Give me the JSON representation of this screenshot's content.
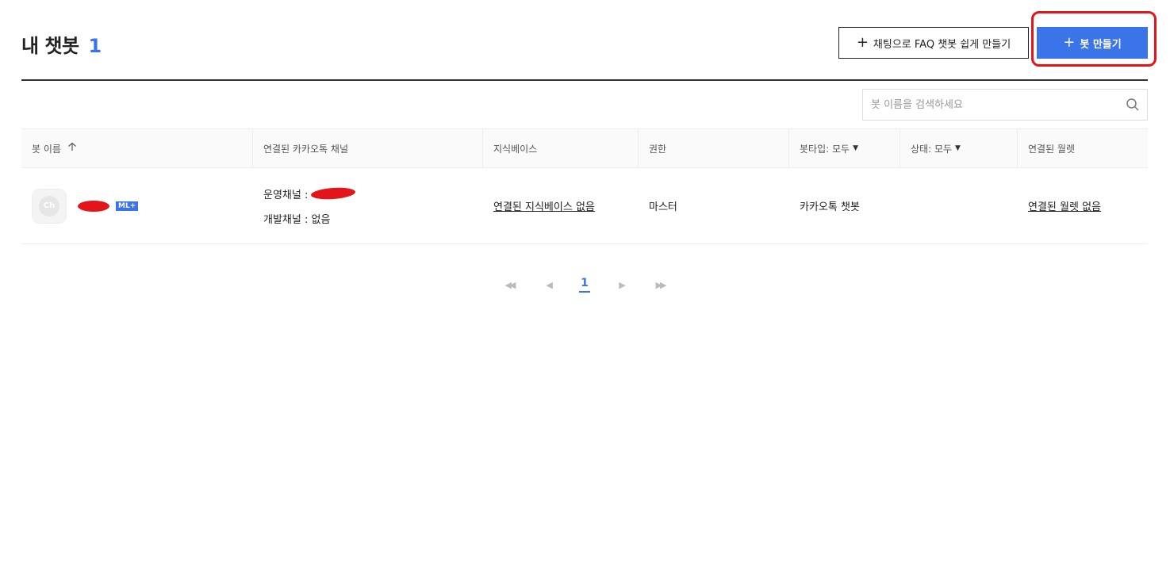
{
  "header": {
    "title": "내 챗봇",
    "count": "1",
    "faq_button_label": "채팅으로 FAQ 챗봇 쉽게 만들기",
    "create_button_label": "봇 만들기",
    "plus_symbol": "+"
  },
  "search": {
    "placeholder": "봇 이름을 검색하세요"
  },
  "table": {
    "headers": {
      "bot_name": "봇 이름",
      "channel": "연결된 카카오톡 채널",
      "knowledge": "지식베이스",
      "permission": "권한",
      "bot_type": "봇타입: 모두",
      "status": "상태: 모두",
      "wallet": "연결된 월렛"
    },
    "rows": [
      {
        "avatar_text": "Ch",
        "badge": "ML+",
        "channel_ops_label": "운영채널 :",
        "channel_dev": "개발채널 : 없음",
        "knowledge": "연결된 지식베이스 없음",
        "permission": "마스터",
        "bot_type": "카카오톡 챗봇",
        "status": "",
        "wallet": "연결된 월렛 없음"
      }
    ]
  },
  "pagination": {
    "first": "◀◀",
    "prev": "◀",
    "current": "1",
    "next": "▶",
    "last": "▶▶"
  },
  "colors": {
    "accent": "#3b73e8",
    "highlight": "#e3141a"
  }
}
